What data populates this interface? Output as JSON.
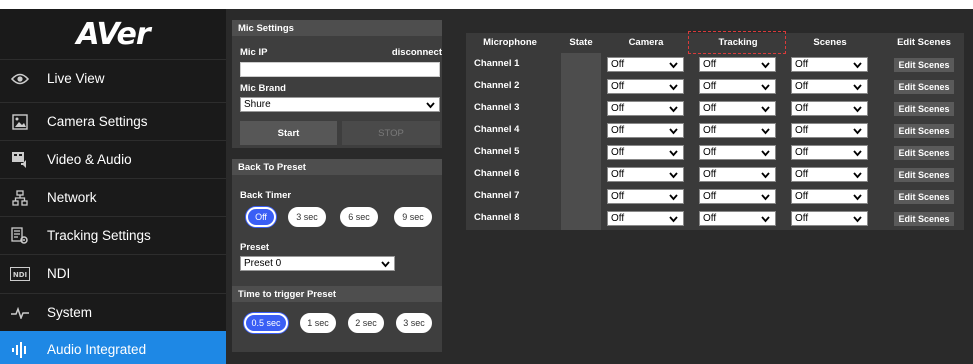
{
  "sidebar": {
    "logo": "AVer",
    "items": [
      {
        "label": "Live View",
        "icon": "eye-icon"
      },
      {
        "label": "Camera Settings",
        "icon": "image-icon"
      },
      {
        "label": "Video & Audio",
        "icon": "video-audio-icon"
      },
      {
        "label": "Network",
        "icon": "network-icon"
      },
      {
        "label": "Tracking Settings",
        "icon": "tracking-icon"
      },
      {
        "label": "NDI",
        "icon": "ndi-icon"
      },
      {
        "label": "System",
        "icon": "pulse-icon"
      },
      {
        "label": "Audio Integrated",
        "icon": "audio-bars-icon"
      }
    ],
    "active_index": 7
  },
  "mic_settings": {
    "title": "Mic Settings",
    "mic_ip_label": "Mic IP",
    "status": "disconnect",
    "mic_ip_value": "",
    "brand_label": "Mic Brand",
    "brand_value": "Shure",
    "start_label": "Start",
    "stop_label": "STOP"
  },
  "back_to_preset": {
    "title": "Back To Preset",
    "timer_label": "Back Timer",
    "timer_options": [
      "Off",
      "3 sec",
      "6 sec",
      "9 sec"
    ],
    "timer_selected": 0,
    "preset_label": "Preset",
    "preset_value": "Preset 0"
  },
  "trigger": {
    "title": "Time to trigger Preset",
    "options": [
      "0.5 sec",
      "1 sec",
      "2 sec",
      "3 sec"
    ],
    "selected": 0
  },
  "table": {
    "headers": {
      "microphone": "Microphone",
      "state": "State",
      "camera": "Camera",
      "tracking": "Tracking",
      "scenes": "Scenes",
      "edit": "Edit Scenes"
    },
    "rows": [
      {
        "channel": "Channel 1",
        "camera": "Off",
        "tracking": "Off",
        "scenes": "Off",
        "edit": "Edit Scenes"
      },
      {
        "channel": "Channel 2",
        "camera": "Off",
        "tracking": "Off",
        "scenes": "Off",
        "edit": "Edit Scenes"
      },
      {
        "channel": "Channel 3",
        "camera": "Off",
        "tracking": "Off",
        "scenes": "Off",
        "edit": "Edit Scenes"
      },
      {
        "channel": "Channel 4",
        "camera": "Off",
        "tracking": "Off",
        "scenes": "Off",
        "edit": "Edit Scenes"
      },
      {
        "channel": "Channel 5",
        "camera": "Off",
        "tracking": "Off",
        "scenes": "Off",
        "edit": "Edit Scenes"
      },
      {
        "channel": "Channel 6",
        "camera": "Off",
        "tracking": "Off",
        "scenes": "Off",
        "edit": "Edit Scenes"
      },
      {
        "channel": "Channel 7",
        "camera": "Off",
        "tracking": "Off",
        "scenes": "Off",
        "edit": "Edit Scenes"
      },
      {
        "channel": "Channel 8",
        "camera": "Off",
        "tracking": "Off",
        "scenes": "Off",
        "edit": "Edit Scenes"
      }
    ]
  },
  "colors": {
    "accent": "#1e88e5",
    "selected_pill": "#3a5ef5",
    "highlight": "#d93a3a"
  }
}
